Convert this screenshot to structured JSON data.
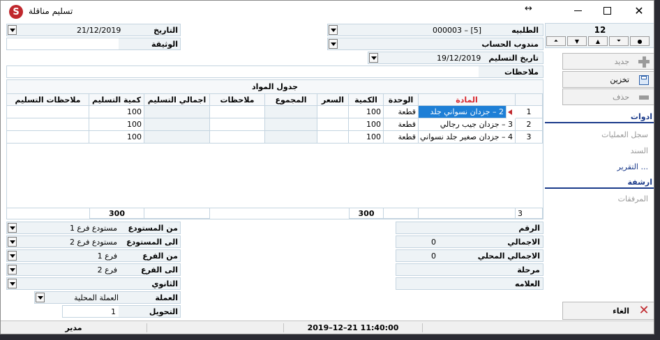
{
  "window": {
    "title": "تسليم مناقلة"
  },
  "record": {
    "counter": "12"
  },
  "header": {
    "date_label": "التاريخ",
    "date_value": "21/12/2019",
    "request_label": "الطلبيه",
    "request_value": "000003 –  [5]",
    "document_label": "الوثيقة",
    "document_value": "",
    "account_rep_label": "مندوب الحساب",
    "account_rep_value": "",
    "delivery_date_label": "تاريخ التسليم",
    "delivery_date_value": "19/12/2019",
    "notes_label": "ملاحظات",
    "notes_value": ""
  },
  "materials_table": {
    "title": "جدول المواد",
    "columns": [
      "المادة",
      "الوحدة",
      "الكمية",
      "السعر",
      "المجموع",
      "ملاحظات",
      "اجمالي التسليم",
      "كمية التسليم",
      "ملاحظات التسليم"
    ],
    "rows": [
      {
        "num": "1",
        "material": "2 – جزدان نسواني جلد",
        "unit": "قطعة",
        "qty": "100",
        "price": "",
        "total": "",
        "notes": "",
        "delivery_total": "",
        "delivery_qty": "100",
        "delivery_notes": ""
      },
      {
        "num": "2",
        "material": "3 – جزدان جيب رجالي",
        "unit": "قطعة",
        "qty": "100",
        "price": "",
        "total": "",
        "notes": "",
        "delivery_total": "",
        "delivery_qty": "100",
        "delivery_notes": ""
      },
      {
        "num": "3",
        "material": "4 – جزدان صغير جلد نسواني",
        "unit": "قطعة",
        "qty": "100",
        "price": "",
        "total": "",
        "notes": "",
        "delivery_total": "",
        "delivery_qty": "100",
        "delivery_notes": ""
      }
    ],
    "footer": {
      "count": "3",
      "qty_sum": "300",
      "delivery_qty_sum": "300"
    }
  },
  "lower_left": {
    "from_warehouse_label": "من المستودع",
    "from_warehouse_value": "مستودع فرع 1",
    "to_warehouse_label": "الى المستودع",
    "to_warehouse_value": "مستودع فرع 2",
    "from_branch_label": "من الفرع",
    "from_branch_value": "فرع 1",
    "to_branch_label": "الى الفرع",
    "to_branch_value": "فرع 2",
    "secondary_label": "الثانوي",
    "secondary_value": "",
    "currency_label": "العملة",
    "currency_value": "العملة المحلية",
    "conversion_label": "التحويل",
    "conversion_value": "1"
  },
  "lower_right": {
    "number_label": "الرقم",
    "number_value": "",
    "total_label": "الاجمالي",
    "total_value": "0",
    "local_total_label": "الاجمالي المحلي",
    "local_total_value": "0",
    "stage_label": "مرحلة",
    "stage_value": "",
    "mark_label": "العلامه",
    "mark_value": ""
  },
  "sidebar": {
    "new_label": "جديد",
    "save_label": "تخزين",
    "delete_label": "حذف",
    "tools_title": "ادوات",
    "ops_log": "سجل العمليات",
    "bond": "السند",
    "report": "التقرير ...",
    "archive_title": "ارشفة",
    "attachments": "المرفقات",
    "cancel_label": "الغاء"
  },
  "status": {
    "user": "مدير",
    "datetime": "2019–12–21 11:40:00"
  },
  "colors": {
    "accent": "#c0282d",
    "header_red": "#d9262c",
    "link_blue": "#1a3a8a",
    "selection": "#1e7fd6"
  }
}
